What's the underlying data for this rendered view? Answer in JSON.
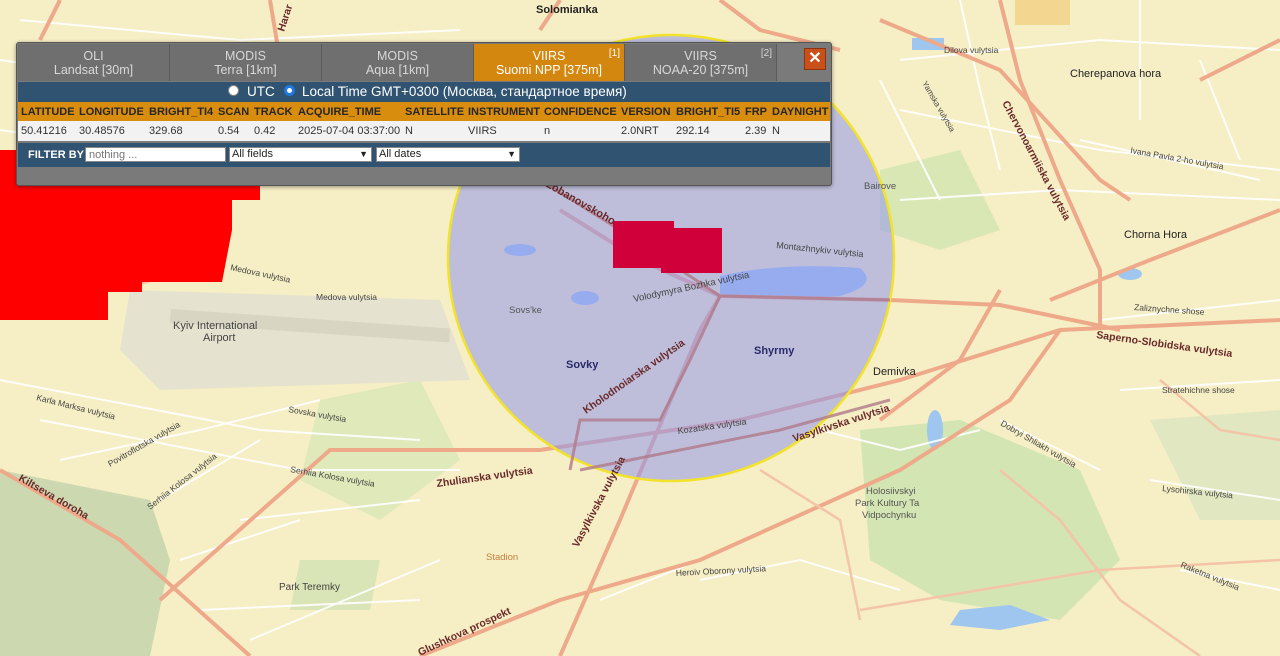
{
  "map": {
    "labels": {
      "solomianka": "Solomianka",
      "cherepanova": "Cherepanova hora",
      "chorna": "Chorna Hora",
      "bairove": "Bairove",
      "airport_1": "Kyiv International",
      "airport_2": "Airport",
      "sovske": "Sovs'ke",
      "sovky": "Sovky",
      "shyrmy": "Shyrmy",
      "demivka": "Demivka",
      "stadion": "Stadion",
      "park_teremky": "Park Teremky",
      "holosiivskyi_1": "Holosiivskyi",
      "holosiivskyi_2": "Park Kultury Ta",
      "holosiivskyi_3": "Vidpochynku",
      "lobanovskoho": "Lobanovskoho",
      "montazhnykiv": "Montazhnykiv vulytsia",
      "bozhka": "Volodymyra Bozhka vulytsia",
      "kholodnoiarska": "Kholodnoiarska vulytsia",
      "kozatska": "Kozatska vulytsia",
      "vasylkivska_1": "Vasylkivska vulytsia",
      "vasylkivska_2": "Vasylkivska vulytsia",
      "zhulianska": "Zhulianska vulytsia",
      "saperno": "Saperno-Slobidska vulytsia",
      "chervonoarmiiska": "Chervonoarmiiska vulytsia",
      "ivana_pavla": "Ivana Pavla 2-ho vulytsia",
      "dilova": "Dilova vulytsia",
      "zaliznychne": "Zaliznychne shose",
      "stratehichne": "Stratehichne shose",
      "dobryi": "Dobryi Shliakh vulytsia",
      "lysohirska": "Lysohirska vulytsia",
      "raketna": "Raketna vulytsia",
      "heroiv": "Heroiv Oborony vulytsia",
      "vasylkivska_3": "Vasylkivska vulytsia",
      "akadem": "Glushkova prospekt",
      "karla_marksa": "Karla Marksa vulytsia",
      "povitroflotska": "Povitroflotska vulytsia",
      "sevastopolska": "Serhiia Kolosa vulytsia",
      "sovska": "Sovska vulytsia",
      "serhiia": "Serhiia Kolosa vulytsia",
      "medova": "Medova vulytsia",
      "medova2": "Medova vulytsia",
      "kiltseva": "Kiltseva doroha",
      "yamska": "Yamska vulytsia",
      "harar": "Harar"
    }
  },
  "panel": {
    "tabs": [
      {
        "line1": "OLI",
        "line2": "Landsat [30m]",
        "badge": ""
      },
      {
        "line1": "MODIS",
        "line2": "Terra [1km]",
        "badge": ""
      },
      {
        "line1": "MODIS",
        "line2": "Aqua [1km]",
        "badge": ""
      },
      {
        "line1": "VIIRS",
        "line2": "Suomi NPP [375m]",
        "badge": "[1]"
      },
      {
        "line1": "VIIRS",
        "line2": "NOAA-20 [375m]",
        "badge": "[2]"
      }
    ],
    "close_label": "✕",
    "time": {
      "utc_label": "UTC",
      "local_label": "Local Time GMT+0300 (Москва, стандартное время)"
    },
    "columns": [
      "LATITUDE",
      "LONGITUDE",
      "BRIGHT_TI4",
      "SCAN",
      "TRACK",
      "ACQUIRE_TIME",
      "SATELLITE",
      "INSTRUMENT",
      "CONFIDENCE",
      "VERSION",
      "BRIGHT_TI5",
      "FRP",
      "DAYNIGHT"
    ],
    "rows": [
      [
        "50.41216",
        "30.48576",
        "329.68",
        "0.54",
        "0.42",
        "2025-07-04 03:37:00",
        "N",
        "VIIRS",
        "n",
        "2.0NRT",
        "292.14",
        "2.39",
        "N"
      ]
    ],
    "filter": {
      "label": "FILTER BY",
      "placeholder": "nothing ...",
      "field_select": "All fields",
      "date_select": "All dates"
    }
  },
  "colors": {
    "active_tab": "#d4870f",
    "header": "#d98d0f",
    "bar": "#2f5370",
    "fire_red": "#ff0000",
    "hotspot": "#d0003a",
    "circle_fill": "#8f97ee",
    "circle_stroke": "#f2e32a"
  }
}
